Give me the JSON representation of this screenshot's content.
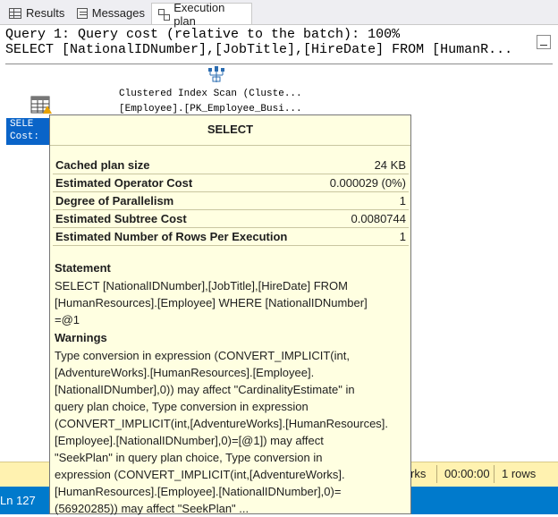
{
  "tabs": [
    {
      "label": "Results",
      "icon": "grid-icon"
    },
    {
      "label": "Messages",
      "icon": "messages-icon"
    },
    {
      "label": "Execution plan",
      "icon": "execution-plan-icon",
      "active": true
    }
  ],
  "query": {
    "header": "Query 1: Query cost (relative to the batch): 100%",
    "sql": "SELECT [NationalIDNumber],[JobTitle],[HireDate] FROM [HumanR..."
  },
  "plan": {
    "scan_line1": "Clustered Index Scan (Cluste...",
    "scan_line2": "[Employee].[PK_Employee_Busi...",
    "select_label_line1": "SELE",
    "select_label_line2": "Cost:"
  },
  "tooltip": {
    "title": "SELECT",
    "rows": [
      {
        "key": "Cached plan size",
        "value": "24 KB"
      },
      {
        "key": "Estimated Operator Cost",
        "value": "0.000029 (0%)"
      },
      {
        "key": "Degree of Parallelism",
        "value": "1"
      },
      {
        "key": "Estimated Subtree Cost",
        "value": "0.0080744"
      },
      {
        "key": "Estimated Number of Rows Per Execution",
        "value": "1"
      }
    ],
    "statement_heading": "Statement",
    "statement_lines": [
      "SELECT [NationalIDNumber],[JobTitle],[HireDate] FROM",
      "[HumanResources].[Employee] WHERE [NationalIDNumber]",
      "=@1"
    ],
    "warnings_heading": "Warnings",
    "warnings_lines": [
      "Type conversion in expression (CONVERT_IMPLICIT(int,",
      "[AdventureWorks].[HumanResources].[Employee].",
      "[NationalIDNumber],0)) may affect \"CardinalityEstimate\" in",
      "query plan choice, Type conversion in expression",
      "(CONVERT_IMPLICIT(int,[AdventureWorks].[HumanResources].",
      "[Employee].[NationalIDNumber],0)=[@1]) may affect",
      "\"SeekPlan\" in query plan choice, Type conversion in",
      "expression (CONVERT_IMPLICIT(int,[AdventureWorks].",
      "[HumanResources].[Employee].[NationalIDNumber],0)=",
      "(56920285)) may affect \"SeekPlan\" ..."
    ]
  },
  "status": {
    "rows_label_fragment": "rks",
    "elapsed": "00:00:00",
    "row_count": "1 rows"
  },
  "editor_status": {
    "line": "Ln 127"
  },
  "colors": {
    "selection": "#0a64c8",
    "tooltip_bg": "#ffffe1",
    "status_bg": "#fff2b0",
    "editor_status_bg": "#007acc",
    "warning": "#e8a200"
  }
}
